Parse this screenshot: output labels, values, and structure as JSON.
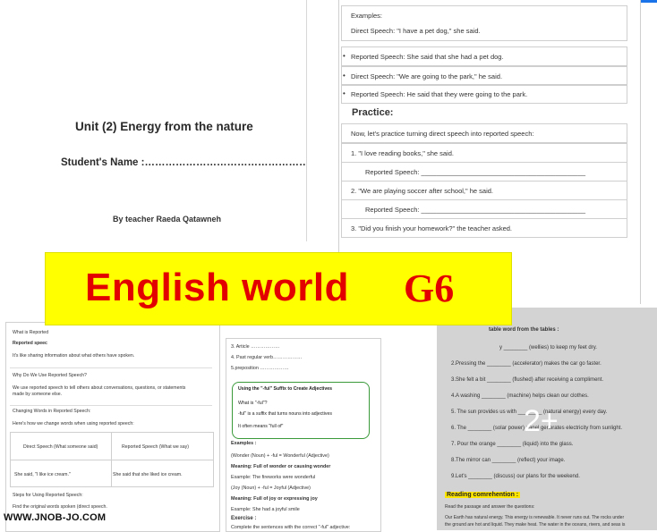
{
  "cover": {
    "title": "Unit (2) Energy from the nature",
    "student": "Student's Name :……………………………………………",
    "teacher": "By teacher Raeda Qatawneh"
  },
  "right_page": {
    "examples_label": "Examples:",
    "ex1": "Direct Speech: \"I have a pet dog,\" she said.",
    "ex2": "Reported Speech: She said that she had a pet dog.",
    "ex3": "Direct Speech: \"We are going to the park,\" he said.",
    "ex4": "Reported Speech: He said that they were going to the park.",
    "practice": "Practice:",
    "practice_intro": "Now, let's practice turning direct speech into reported speech:",
    "q1": "1.  \"I love reading books,\" she said.",
    "q1r": "Reported Speech: ____________________________________________",
    "q2": "2.  \"We are playing soccer after school,\" he said.",
    "q2r": "Reported Speech: ____________________________________________",
    "q3": "3.  \"Did you finish your homework?\" the teacher asked."
  },
  "banner": {
    "text": "English world",
    "grade": "G6",
    "bg": "#ffff00",
    "color": "#e30000"
  },
  "bottom_left": {
    "l1": "What is Reported",
    "l2": "Reported speec",
    "l3": "It's like sharing information about what others have spoken.",
    "l4": "Why Do We Use Reported Speech?",
    "l5": "We use reported speech to tell others about conversations, questions, or statements",
    "l6": "made by someone else.",
    "l7": "Changing Words in Reported Speech:",
    "l8": "Here's how we change words when using reported speech:",
    "th1": "Direct Speech (What someone said)",
    "th2": "Reported Speech (What we say)",
    "td1": "She said, \"I like ice cream.\"",
    "td2": "She said that she liked ice cream.",
    "l9": "Steps for Using Reported Speech:",
    "l10": "Find the original words spoken (direct speech."
  },
  "bottom_mid": {
    "l1": "3. Article ………………",
    "l2": "4. Past regular verb………………",
    "l3": "5.preposition ………………",
    "g1": "Using the \"-ful\" Suffix to Create Adjectives",
    "g2": "What is \"-ful\"?",
    "g3": "-ful\" is a suffix that turns nouns into adjectives",
    "g4": "It often means \"full of\"",
    "l4": "Examples :",
    "l5": "(Wonder (Noun) + -ful = Wonderful (Adjective)",
    "l6": "Meaning: Full of wonder or causing wonder",
    "l7": "Example: The fireworks were wonderful",
    "l8": "(Joy (Noun) + -ful = Joyful (Adjective)",
    "l9": "Meaning: Full of joy or expressing joy",
    "l10": "Example: She had a joyful smile",
    "l11": "Exercise :",
    "l12": "Complete the sentences with the correct \"-ful\" adjective:"
  },
  "bottom_right": {
    "l0": "table word from the tables :",
    "l1": "y ________ (wellies) to keep my feet dry.",
    "l2": "2.Pressing the ________ (accelerator) makes the car go faster.",
    "l3": "3.She felt a bit ________ (flushed) after receiving a compliment.",
    "l4": "4.A washing ________ (machine) helps clean our clothes.",
    "l5": "5. The sun provides us with ________ (natural energy) every day.",
    "l6": "6. The ________ (solar power) panel generates electricity from sunlight.",
    "l7": "7. Pour the orange ________ (liquid) into the glass.",
    "l8": "8.The mirror can ________ (reflect) your image.",
    "l9": "9.Let's ________ (discuss) our plans for the weekend.",
    "reading": "Reading comrehention :",
    "r1": "Read the passage and answer the questions:",
    "r2": "Our Earth has natural energy. This energy is renewable. It never runs out. The rocks under",
    "r3": "the ground are hot and liquid. They make heat. The water in the oceans, rivers, and seas is",
    "more": "2+"
  },
  "watermark": "WWW.JNOB-JO.COM"
}
